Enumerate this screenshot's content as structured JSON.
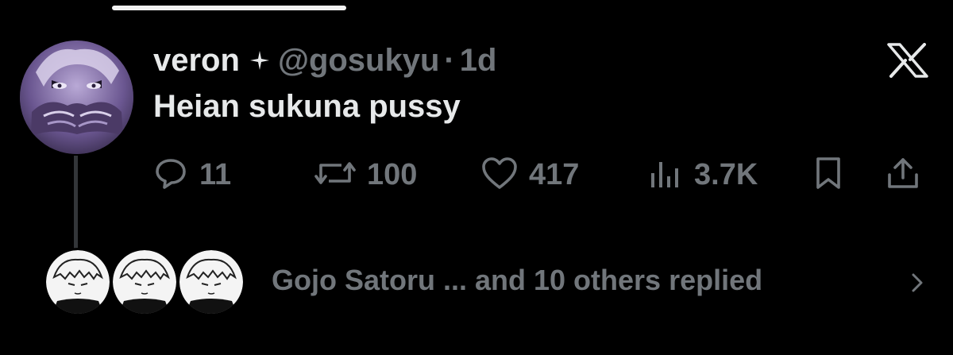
{
  "tweet": {
    "author": {
      "display_name": "veron",
      "badge_icon": "sparkle-icon",
      "handle": "@gosukyu",
      "separator": "·",
      "time_ago": "1d"
    },
    "text": "Heian sukuna pussy",
    "platform_logo": "x-logo-icon",
    "stats": {
      "replies": "11",
      "reposts": "100",
      "likes": "417",
      "views": "3.7K"
    },
    "actions": {
      "reply_icon": "reply-icon",
      "repost_icon": "repost-icon",
      "like_icon": "heart-icon",
      "views_icon": "views-icon",
      "bookmark_icon": "bookmark-icon",
      "share_icon": "share-icon"
    }
  },
  "replies_summary": {
    "text": "Gojo Satoru ... and 10 others replied",
    "avatar_count": 3
  },
  "colors": {
    "background": "#000000",
    "primary_text": "#e7e9ea",
    "secondary_text": "#71767b",
    "thread_line": "#333639"
  }
}
